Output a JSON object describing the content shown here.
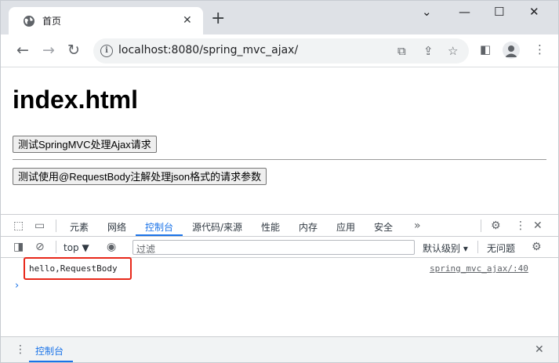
{
  "browser": {
    "tab_title": "首页",
    "url": "localhost:8080/spring_mvc_ajax/"
  },
  "page": {
    "heading": "index.html",
    "button1": "测试SpringMVC处理Ajax请求",
    "button2": "测试使用@RequestBody注解处理json格式的请求参数"
  },
  "devtools": {
    "tabs": [
      "元素",
      "网络",
      "控制台",
      "源代码/来源",
      "性能",
      "内存",
      "应用",
      "安全"
    ],
    "active_tab": "控制台",
    "context": "top",
    "filter_placeholder": "过滤",
    "levels": "默认级别",
    "issues": "无问题",
    "log": {
      "message": "hello,RequestBody",
      "source": "spring_mvc_ajax/:40"
    },
    "drawer_tab": "控制台"
  },
  "colors": {
    "accent": "#1a73e8",
    "highlight": "#e8281a"
  }
}
